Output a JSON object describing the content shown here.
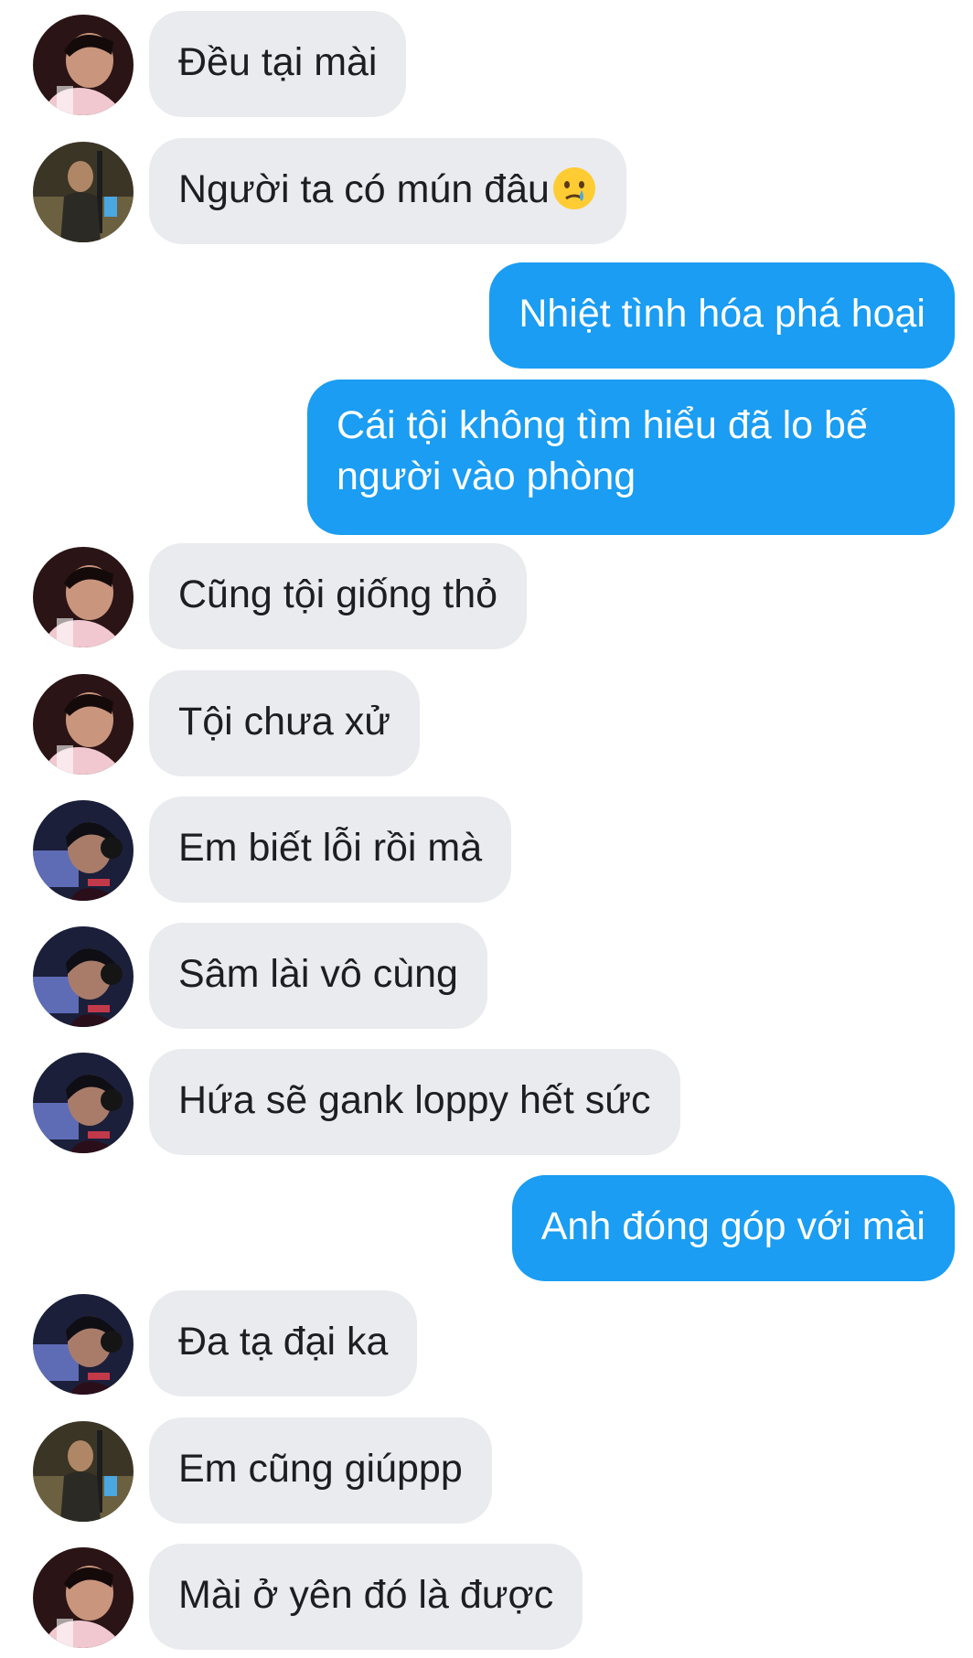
{
  "conversation": {
    "messages": [
      {
        "direction": "incoming",
        "sender": "avatar-boy-pink-hoodie",
        "text": "Đều tại mài"
      },
      {
        "direction": "incoming",
        "sender": "avatar-guy-gym",
        "text": "Người ta có mún đâu",
        "emoji": "crying-face-emoji"
      },
      {
        "direction": "outgoing",
        "text": "Nhiệt tình hóa phá hoại"
      },
      {
        "direction": "outgoing",
        "text": "Cái tội không tìm hiểu đã lo bế người vào phòng"
      },
      {
        "direction": "incoming",
        "sender": "avatar-boy-pink-hoodie",
        "text": "Cũng tội giống thỏ"
      },
      {
        "direction": "incoming",
        "sender": "avatar-boy-pink-hoodie",
        "text": "Tội chưa xử"
      },
      {
        "direction": "incoming",
        "sender": "avatar-gamer-headset",
        "text": "Em biết lỗi rồi mà"
      },
      {
        "direction": "incoming",
        "sender": "avatar-gamer-headset",
        "text": "Sâm lài vô cùng"
      },
      {
        "direction": "incoming",
        "sender": "avatar-gamer-headset",
        "text": "Hứa sẽ gank loppy hết sức"
      },
      {
        "direction": "outgoing",
        "text": "Anh đóng góp với mài"
      },
      {
        "direction": "incoming",
        "sender": "avatar-gamer-headset",
        "text": "Đa tạ đại ka"
      },
      {
        "direction": "incoming",
        "sender": "avatar-guy-gym",
        "text": "Em cũng giúppp"
      },
      {
        "direction": "incoming",
        "sender": "avatar-boy-pink-hoodie",
        "text": "Mài ở yên đó là được"
      }
    ]
  },
  "colors": {
    "incoming_bubble": "#e9ebee",
    "outgoing_bubble": "#1a9df2",
    "incoming_text": "#1c1e21",
    "outgoing_text": "#ffffff",
    "background": "#ffffff"
  }
}
